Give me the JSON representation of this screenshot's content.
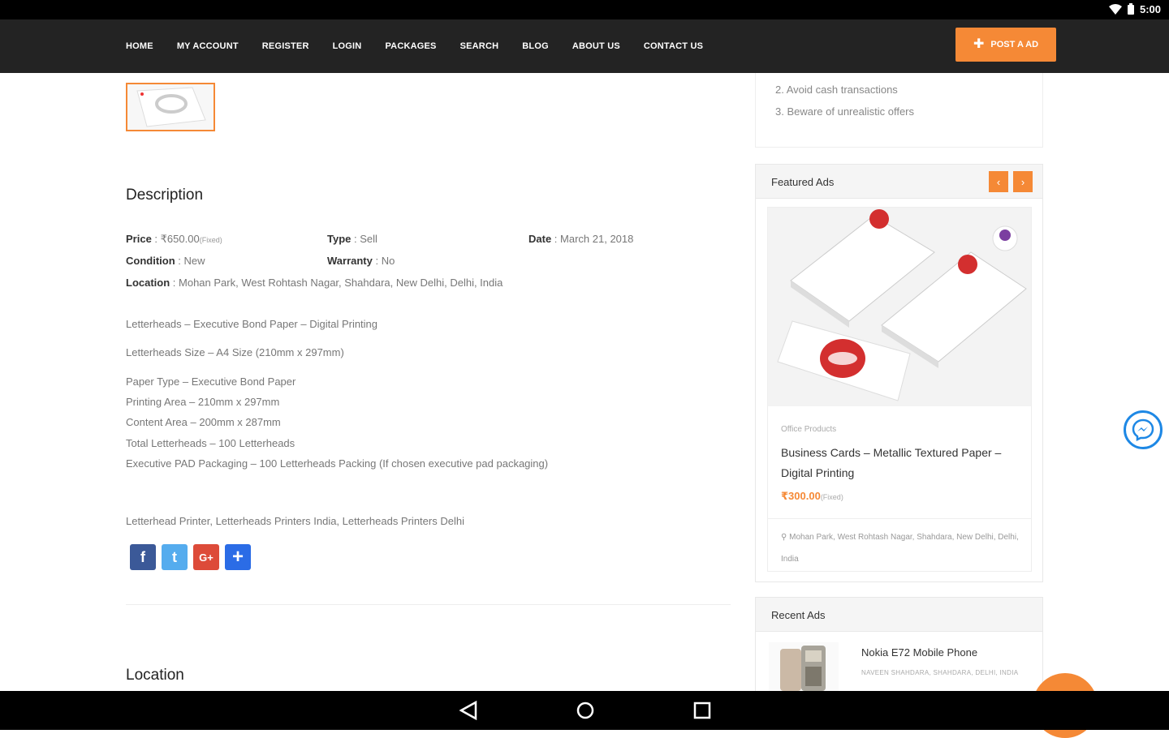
{
  "status": {
    "time": "5:00"
  },
  "nav": {
    "links": [
      "HOME",
      "MY ACCOUNT",
      "REGISTER",
      "LOGIN",
      "PACKAGES",
      "SEARCH",
      "BLOG",
      "ABOUT US",
      "CONTACT US"
    ],
    "post_ad": "POST A AD"
  },
  "colors": {
    "accent": "#f58936",
    "navbar": "#232323",
    "messenger": "#1e88e5"
  },
  "description": {
    "title": "Description",
    "price_label": "Price",
    "price_value": "₹650.00",
    "price_note": "(Fixed)",
    "type_label": "Type",
    "type_value": "Sell",
    "date_label": "Date",
    "date_value": "March 21, 2018",
    "condition_label": "Condition",
    "condition_value": "New",
    "warranty_label": "Warranty",
    "warranty_value": "No",
    "location_label": "Location",
    "location_value": "Mohan Park, West Rohtash Nagar, Shahdara, New Delhi, Delhi, India",
    "lines": [
      "Letterheads – Executive Bond Paper – Digital Printing",
      "Letterheads Size – A4 Size (210mm x 297mm)",
      "Paper Type – Executive Bond Paper",
      "Printing Area – 210mm x 297mm",
      "Content Area – 200mm x 287mm",
      "Total Letterheads – 100 Letterheads",
      "Executive PAD Packaging – 100 Letterheads Packing (If chosen executive pad packaging)"
    ],
    "tags": "Letterhead Printer, Letterheads Printers India, Letterheads Printers Delhi"
  },
  "social": {
    "facebook": "f",
    "twitter": "t",
    "google": "G+",
    "share": "+"
  },
  "location_title": "Location",
  "tips": [
    "2. Avoid cash transactions",
    "3. Beware of unrealistic offers"
  ],
  "featured": {
    "title": "Featured Ads",
    "prev": "‹",
    "next": "›",
    "category": "Office Products",
    "ad_title": "Business Cards – Metallic Textured Paper – Digital Printing",
    "price": "₹300.00",
    "price_note": "(Fixed)",
    "location": "Mohan Park, West Rohtash Nagar, Shahdara, New Delhi, Delhi, India"
  },
  "recent": {
    "title": "Recent Ads",
    "ad_title": "Nokia E72 Mobile Phone",
    "ad_sub": "NAVEEN SHAHDARA, SHAHDARA, DELHI, INDIA"
  }
}
